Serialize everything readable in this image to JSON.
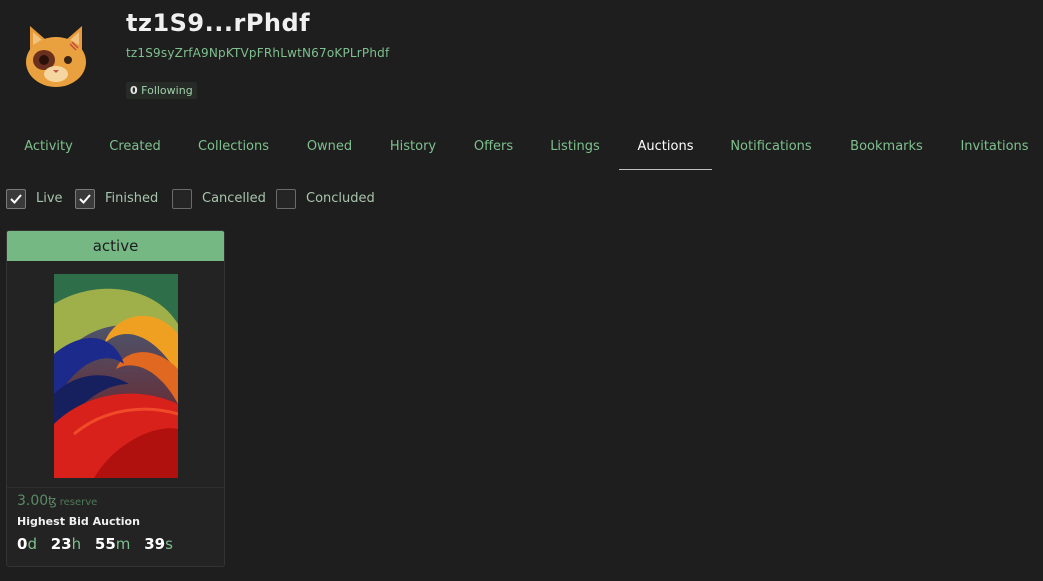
{
  "profile": {
    "short_address": "tz1S9...rPhdf",
    "full_address": "tz1S9syZrfA9NpKTVpFRhLwtN67oKPLrPhdf",
    "following_count": "0",
    "following_label": "Following",
    "avatar_icon": "cat-avatar-icon"
  },
  "tabs": [
    {
      "label": "Activity"
    },
    {
      "label": "Created"
    },
    {
      "label": "Collections"
    },
    {
      "label": "Owned"
    },
    {
      "label": "History"
    },
    {
      "label": "Offers"
    },
    {
      "label": "Listings"
    },
    {
      "label": "Auctions",
      "active": true
    },
    {
      "label": "Notifications"
    },
    {
      "label": "Bookmarks"
    },
    {
      "label": "Invitations"
    }
  ],
  "filters": [
    {
      "label": "Live",
      "checked": true
    },
    {
      "label": "Finished",
      "checked": true
    },
    {
      "label": "Cancelled",
      "checked": false
    },
    {
      "label": "Concluded",
      "checked": false
    }
  ],
  "auction": {
    "status": "active",
    "price": "3.00",
    "currency_symbol": "ꜩ",
    "price_note": "reserve",
    "type": "Highest Bid Auction",
    "countdown": {
      "days": "0",
      "days_unit": "d",
      "hours": "23",
      "hours_unit": "h",
      "minutes": "55",
      "minutes_unit": "m",
      "seconds": "39",
      "seconds_unit": "s"
    }
  },
  "colors": {
    "background": "#1e1e1e",
    "accent": "#7ec08e",
    "status_active": "#75b884"
  }
}
